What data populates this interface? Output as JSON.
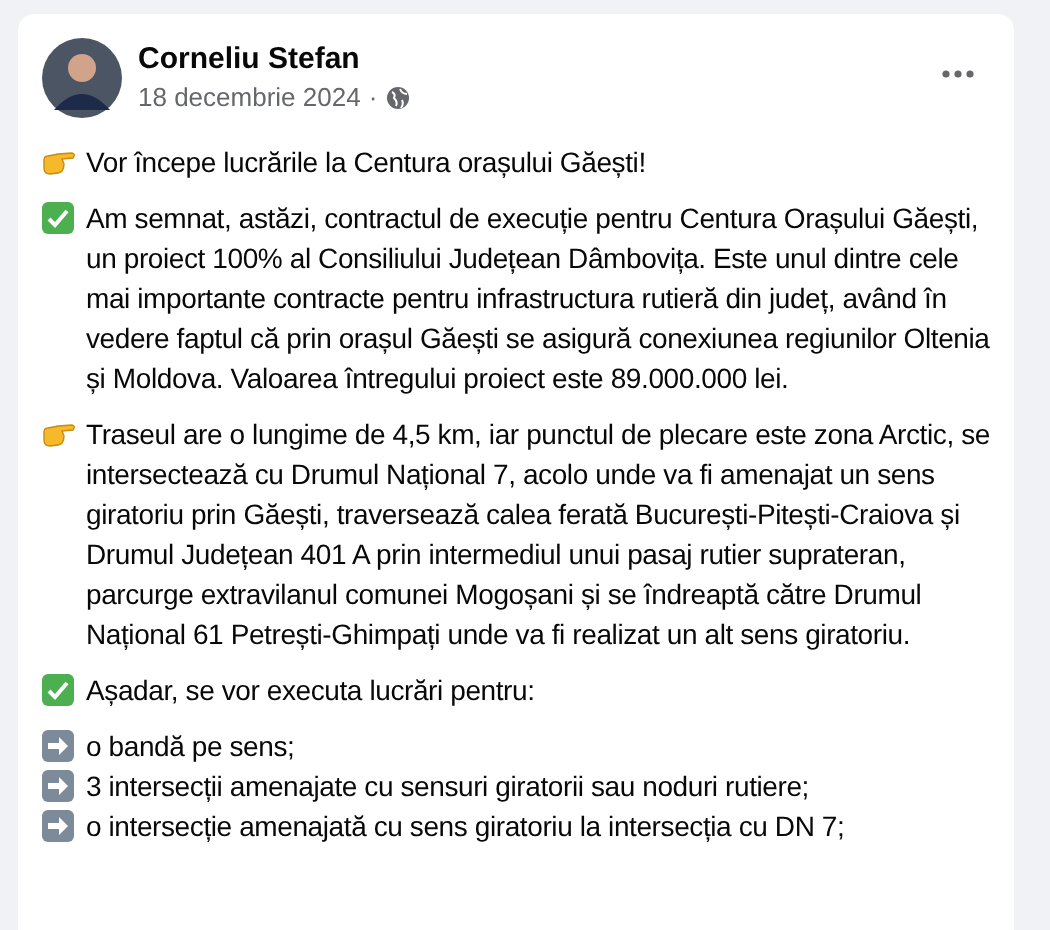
{
  "post": {
    "author": "Corneliu Stefan",
    "date": "18 decembrie 2024",
    "separator": "·",
    "paragraphs": [
      {
        "kind": "point",
        "text": "Vor începe lucrările la Centura orașului Găești!"
      },
      {
        "kind": "check",
        "text": "Am semnat, astăzi, contractul de execuție pentru Centura Orașului Găești, un proiect 100% al Consiliului Județean Dâmbovița. Este unul dintre cele mai importante contracte pentru infrastructura rutieră din județ, având în vedere faptul că prin orașul Găești se asigură conexiunea regiunilor Oltenia și Moldova. Valoarea întregului proiect este 89.000.000 lei."
      },
      {
        "kind": "point",
        "text": "Traseul are o lungime de 4,5 km, iar punctul de plecare este zona Arctic, se intersectează cu Drumul Național 7, acolo unde va fi amenajat un sens giratoriu prin Găești, traversează calea ferată București-Pitești-Craiova și Drumul Județean 401 A prin intermediul unui pasaj rutier suprateran, parcurge extravilanul comunei Mogoșani și se îndreaptă către Drumul Național 61 Petrești-Ghimpați unde va fi realizat un alt sens giratoriu."
      },
      {
        "kind": "check",
        "text": "Așadar, se vor executa lucrări pentru:"
      }
    ],
    "list": [
      {
        "kind": "arrow",
        "text": "o bandă pe sens;"
      },
      {
        "kind": "arrow",
        "text": "3 intersecții amenajate cu sensuri giratorii sau noduri rutiere;"
      },
      {
        "kind": "arrow",
        "text": "o intersecție amenajată cu sens giratoriu la intersecția cu DN 7;"
      }
    ]
  }
}
